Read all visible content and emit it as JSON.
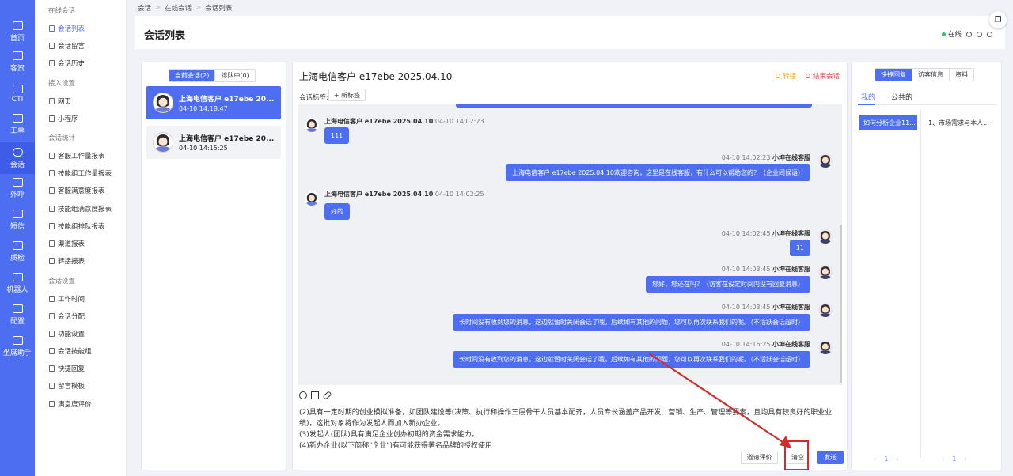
{
  "rail": [
    {
      "label": "首页",
      "icon": "home-icon"
    },
    {
      "label": "客资",
      "icon": "customer-icon"
    },
    {
      "label": "CTI",
      "icon": "cti-icon"
    },
    {
      "label": "工单",
      "icon": "ticket-icon"
    },
    {
      "label": "会话",
      "icon": "chat-icon",
      "active": true
    },
    {
      "label": "外呼",
      "icon": "phone-icon"
    },
    {
      "label": "短信",
      "icon": "sms-icon"
    },
    {
      "label": "质检",
      "icon": "inspect-icon"
    },
    {
      "label": "机器人",
      "icon": "robot-icon"
    },
    {
      "label": "配置",
      "icon": "config-icon"
    },
    {
      "label": "坐席助手",
      "icon": "assistant-icon"
    }
  ],
  "menu": {
    "groups": [
      "在线会话",
      "接入设置",
      "会话统计",
      "会话设置"
    ],
    "items": [
      "会话列表",
      "会话留言",
      "会话历史",
      "网页",
      "小程序",
      "客服工作量报表",
      "技能组工作量报表",
      "客服满意度报表",
      "技能组满意度报表",
      "技能组排队报表",
      "渠道报表",
      "转接报表",
      "工作时间",
      "会话分配",
      "功能设置",
      "会话技能组",
      "快捷回复",
      "留言模板",
      "满意度评价"
    ]
  },
  "breadcrumb": [
    "会话",
    "在线会话",
    "会话列表"
  ],
  "header": {
    "title": "会话列表",
    "status": "在线"
  },
  "sessions": {
    "tabs": [
      "当前会话(2)",
      "排队中(0)"
    ],
    "items": [
      {
        "name": "上海电信客户 e17ebe 20...",
        "time": "04-10 14:18:47"
      },
      {
        "name": "上海电信客户 e17ebe 20...",
        "time": "04-10 14:15:25"
      }
    ]
  },
  "chat": {
    "title": "上海电信客户 e17ebe 2025.04.10",
    "transfer": "转接",
    "end": "结束会话",
    "tag_label": "会话标签:",
    "new_tag": "+ 新标签",
    "customer_name": "上海电信客户 e17ebe 2025.04.10",
    "agent_name": "小坤在线客服",
    "messages": [
      {
        "from": "customer",
        "time": "04-10 14:02:23",
        "text": "111"
      },
      {
        "from": "agent",
        "time": "04-10 14:02:23",
        "text": "上海电信客户 e17ebe 2025.04.10欢迎咨询，这里是在线客服，有什么可以帮助您的？（企业间候语）"
      },
      {
        "from": "customer",
        "time": "04-10 14:02:25",
        "text": "好的"
      },
      {
        "from": "agent",
        "time": "04-10 14:02:45",
        "text": "11"
      },
      {
        "from": "agent",
        "time": "04-10 14:03:45",
        "text": "您好，您还在吗？（访客在设定时间内没有回复消息）"
      },
      {
        "from": "agent",
        "time": "04-10 14:03:45",
        "text": "长时间没有收到您的消息，这边就暂时关闭会话了哦。后续如有其他的问题，您可以再次联系我们的呢。（不活跃会话超时）"
      },
      {
        "from": "agent",
        "time": "04-10 14:16:25",
        "text": "长时间没有收到您的消息，这边就暂时关闭会话了哦。后续如有其他的问题，您可以再次联系我们的呢。（不活跃会话超时）"
      }
    ],
    "draft": [
      "(2)具有一定时期的创业模拟准备，如团队建设等(决策、执行和操作三层骨干人员基本配齐，人员专长涵盖产品开发、营销、生产、管理等要素，且均具有较良好的职业业绩)，这批对象将作为发起人而加入新办企业。",
      "(3)发起人(团队)具有满足企业创办初期的资金需求能力。",
      "(4)新办企业(以下简称\"企业\")有可能获得著名品牌的授权使用"
    ],
    "invite": "邀请评价",
    "clear": "清空",
    "send": "发送"
  },
  "quick": {
    "tabs": [
      "快捷回复",
      "访客信息",
      "资料"
    ],
    "sub_tabs": [
      "我的",
      "公共的"
    ],
    "items": [
      "如何分析企业11...",
      "1、市场需求与本人..."
    ],
    "page": "1"
  },
  "colors": {
    "primary": "#4e6ef2",
    "online": "#28c76f",
    "transfer": "#f5a623",
    "end": "#e84a4a",
    "annotation": "#d12d2d"
  }
}
